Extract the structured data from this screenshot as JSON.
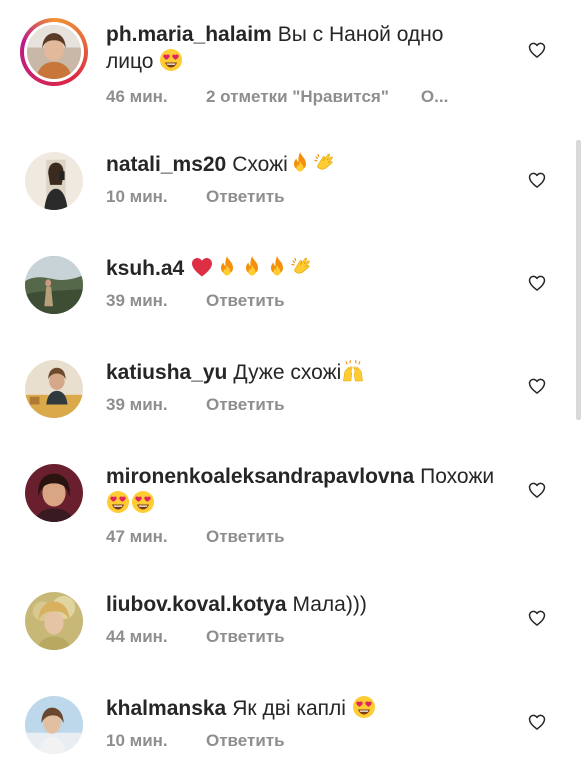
{
  "comments": [
    {
      "username": "ph.maria_halaim",
      "text_line1": "Вы с Наной одно",
      "text_line2": "лицо",
      "emojis": [
        "heart-eyes"
      ],
      "time": "46 мин.",
      "likes": "2 отметки \"Нравится\"",
      "reply": "О...",
      "has_story": true
    },
    {
      "username": "natali_ms20",
      "text": "Схожі",
      "emojis": [
        "fire",
        "clap"
      ],
      "time": "10 мин.",
      "reply": "Ответить"
    },
    {
      "username": "ksuh.a4",
      "text": "",
      "emojis": [
        "red-heart",
        "fire",
        "fire",
        "fire",
        "clap"
      ],
      "time": "39 мин.",
      "reply": "Ответить"
    },
    {
      "username": "katiusha_yu",
      "text": "Дуже схожі",
      "emojis": [
        "raised-hands"
      ],
      "time": "39 мин.",
      "reply": "Ответить"
    },
    {
      "username": "mironenkoaleksandrapavlovna",
      "text": "Похожи",
      "emojis": [
        "heart-eyes",
        "heart-eyes"
      ],
      "time": "47 мин.",
      "reply": "Ответить"
    },
    {
      "username": "liubov.koval.kotya",
      "text": "Мала)))",
      "emojis": [],
      "time": "44 мин.",
      "reply": "Ответить"
    },
    {
      "username": "khalmanska",
      "text": "Як дві каплі",
      "emojis": [
        "heart-eyes"
      ],
      "time": "10 мин.",
      "reply": "Ответить"
    }
  ],
  "icons": {
    "like": "heart-outline-icon"
  },
  "colors": {
    "text": "#262626",
    "meta": "#8e8e8e",
    "heart_outline": "#262626"
  }
}
